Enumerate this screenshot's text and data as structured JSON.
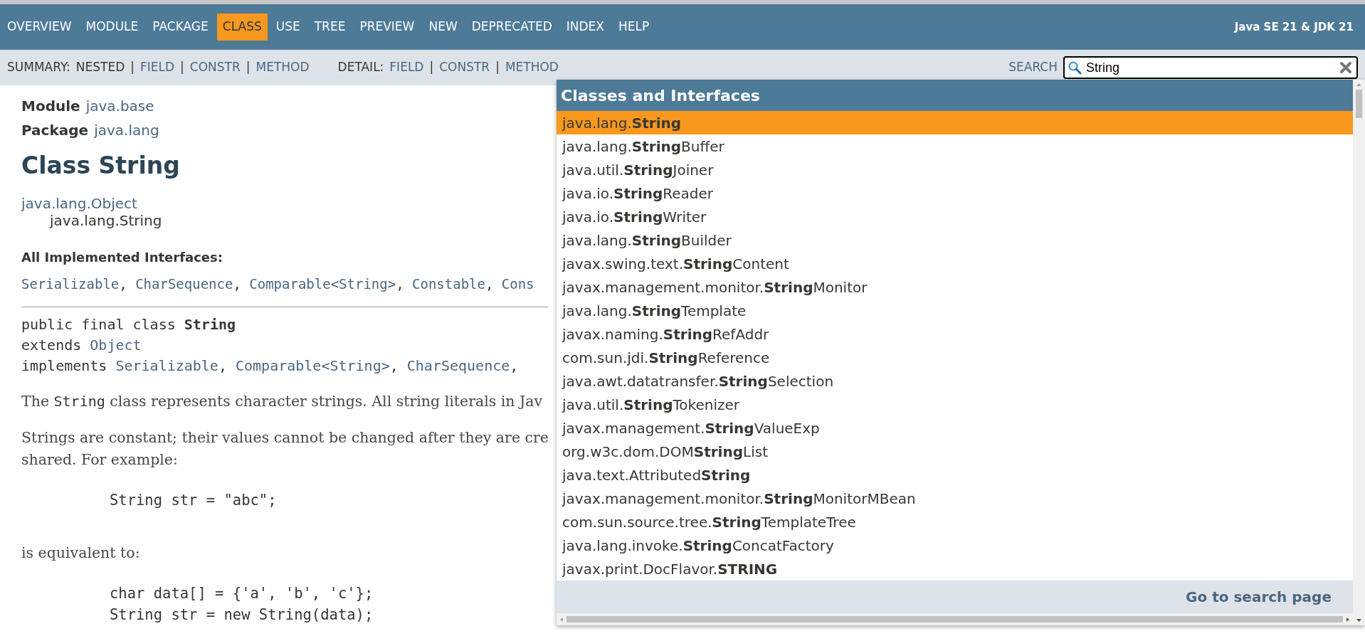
{
  "top_nav": {
    "items": [
      {
        "label": "OVERVIEW",
        "selected": false
      },
      {
        "label": "MODULE",
        "selected": false
      },
      {
        "label": "PACKAGE",
        "selected": false
      },
      {
        "label": "CLASS",
        "selected": true
      },
      {
        "label": "USE",
        "selected": false
      },
      {
        "label": "TREE",
        "selected": false
      },
      {
        "label": "PREVIEW",
        "selected": false
      },
      {
        "label": "NEW",
        "selected": false
      },
      {
        "label": "DEPRECATED",
        "selected": false
      },
      {
        "label": "INDEX",
        "selected": false
      },
      {
        "label": "HELP",
        "selected": false
      }
    ],
    "about": "Java SE 21 & JDK 21"
  },
  "sub_nav": {
    "groups": [
      {
        "label": "SUMMARY:",
        "items": [
          {
            "kind": "plain",
            "text": "NESTED"
          },
          {
            "kind": "separator",
            "text": "|"
          },
          {
            "kind": "link",
            "text": "FIELD"
          },
          {
            "kind": "separator",
            "text": "|"
          },
          {
            "kind": "link",
            "text": "CONSTR"
          },
          {
            "kind": "separator",
            "text": "|"
          },
          {
            "kind": "link",
            "text": "METHOD"
          }
        ]
      },
      {
        "label": "DETAIL:",
        "items": [
          {
            "kind": "link",
            "text": "FIELD"
          },
          {
            "kind": "separator",
            "text": "|"
          },
          {
            "kind": "link",
            "text": "CONSTR"
          },
          {
            "kind": "separator",
            "text": "|"
          },
          {
            "kind": "link",
            "text": "METHOD"
          }
        ]
      }
    ],
    "search": {
      "label": "SEARCH",
      "value": "String"
    }
  },
  "content": {
    "module": {
      "label": "Module",
      "value": "java.base"
    },
    "package": {
      "label": "Package",
      "value": "java.lang"
    },
    "title": "Class String",
    "hierarchy": [
      {
        "text": "java.lang.Object",
        "kind": "link"
      },
      {
        "text": "java.lang.String",
        "kind": "text"
      }
    ],
    "interfaces_heading": "All Implemented Interfaces:",
    "interfaces": [
      [
        {
          "kind": "link",
          "text": "Serializable"
        },
        {
          "kind": "text",
          "text": ","
        },
        {
          "kind": "link",
          "text": "CharSequence"
        },
        {
          "kind": "text",
          "text": ","
        },
        {
          "kind": "link",
          "text": "Comparable<String>"
        },
        {
          "kind": "text",
          "text": ","
        },
        {
          "kind": "link",
          "text": "Constable"
        },
        {
          "kind": "text",
          "text": ","
        },
        {
          "kind": "link",
          "text": "Cons"
        }
      ]
    ],
    "declaration": [
      [
        {
          "kind": "text",
          "text": "public final class **String**"
        }
      ],
      [
        {
          "kind": "text",
          "text": "extends"
        },
        {
          "kind": "link",
          "text": "Object"
        }
      ],
      [
        {
          "kind": "text",
          "text": "implements"
        },
        {
          "kind": "link",
          "text": "Serializable"
        },
        {
          "kind": "text",
          "text": ","
        },
        {
          "kind": "link",
          "text": "Comparable<String>"
        },
        {
          "kind": "text",
          "text": ","
        },
        {
          "kind": "link",
          "text": "CharSequence"
        },
        {
          "kind": "text",
          "text": ","
        }
      ]
    ],
    "body": [
      {
        "kind": "paragraph",
        "lines": [
          [
            {
              "kind": "text",
              "text": "The "
            },
            {
              "kind": "code",
              "text": "String"
            },
            {
              "kind": "text",
              "text": " class represents character strings. All string literals in Jav"
            }
          ]
        ]
      },
      {
        "kind": "paragraph",
        "lines": [
          [
            {
              "kind": "text",
              "text": "Strings are constant; their values cannot be changed after they are cre"
            }
          ],
          [
            {
              "kind": "text",
              "text": "shared. For example:"
            }
          ]
        ]
      },
      {
        "kind": "code",
        "lines": [
          "String str = \"abc\";"
        ]
      },
      {
        "kind": "paragraph",
        "lines": [
          [
            {
              "kind": "text",
              "text": "is equivalent to:"
            }
          ]
        ]
      },
      {
        "kind": "code",
        "lines": [
          "char data[] = {'a', 'b', 'c'};",
          "String str = new String(data);"
        ]
      }
    ]
  },
  "search_results": {
    "heading": "Classes and Interfaces",
    "items": [
      {
        "text": "java.lang.**String**",
        "selected": true
      },
      {
        "text": "java.lang.**String**Buffer",
        "selected": false
      },
      {
        "text": "java.util.**String**Joiner",
        "selected": false
      },
      {
        "text": "java.io.**String**Reader",
        "selected": false
      },
      {
        "text": "java.io.**String**Writer",
        "selected": false
      },
      {
        "text": "java.lang.**String**Builder",
        "selected": false
      },
      {
        "text": "javax.swing.text.**String**Content",
        "selected": false
      },
      {
        "text": "javax.management.monitor.**String**Monitor",
        "selected": false
      },
      {
        "text": "java.lang.**String**Template",
        "selected": false
      },
      {
        "text": "javax.naming.**String**RefAddr",
        "selected": false
      },
      {
        "text": "com.sun.jdi.**String**Reference",
        "selected": false
      },
      {
        "text": "java.awt.datatransfer.**String**Selection",
        "selected": false
      },
      {
        "text": "java.util.**String**Tokenizer",
        "selected": false
      },
      {
        "text": "javax.management.**String**ValueExp",
        "selected": false
      },
      {
        "text": "org.w3c.dom.DOM**String**List",
        "selected": false
      },
      {
        "text": "java.text.Attributed**String**",
        "selected": false
      },
      {
        "text": "javax.management.monitor.**String**MonitorMBean",
        "selected": false
      },
      {
        "text": "com.sun.source.tree.**String**TemplateTree",
        "selected": false
      },
      {
        "text": "java.lang.invoke.**String**ConcatFactory",
        "selected": false
      },
      {
        "text": "javax.print.DocFlavor.**STRING**",
        "selected": false
      }
    ],
    "footer_link": "Go to search page"
  }
}
